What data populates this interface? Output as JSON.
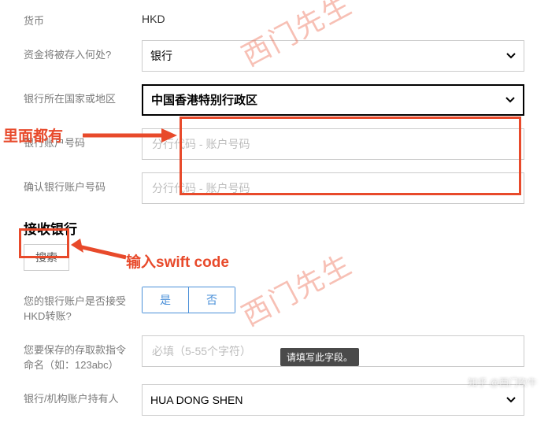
{
  "form": {
    "currency_label": "货币",
    "currency_value": "HKD",
    "deposit_label": "资金将被存入何处?",
    "deposit_select": "银行",
    "country_label": "银行所在国家或地区",
    "country_select": "中国香港特别行政区",
    "account_label": "银行账户号码",
    "account_placeholder": "分行代码 - 账户号码",
    "confirm_label": "确认银行账户号码",
    "confirm_placeholder": "分行代码 - 账户号码",
    "section_title": "接收银行",
    "search_box": "搜索",
    "accept_label": "您的银行账户是否接受HKD转账?",
    "btn_yes": "是",
    "btn_no": "否",
    "instruction_label": "您要保存的存取款指令命名（如：123abc）",
    "instruction_placeholder": "必填（5-55个字符）",
    "tooltip": "请填写此字段。",
    "holder_label": "银行/机构账户持有人",
    "holder_value": "HUA DONG SHEN"
  },
  "annotations": {
    "left_text": "里面都有",
    "swift_text": "输入swift code",
    "watermark": "西门先生",
    "footer_mark": "知乎 @西门吹牛"
  },
  "colors": {
    "accent_red": "#e84a2b",
    "link_blue": "#4a90d9"
  }
}
